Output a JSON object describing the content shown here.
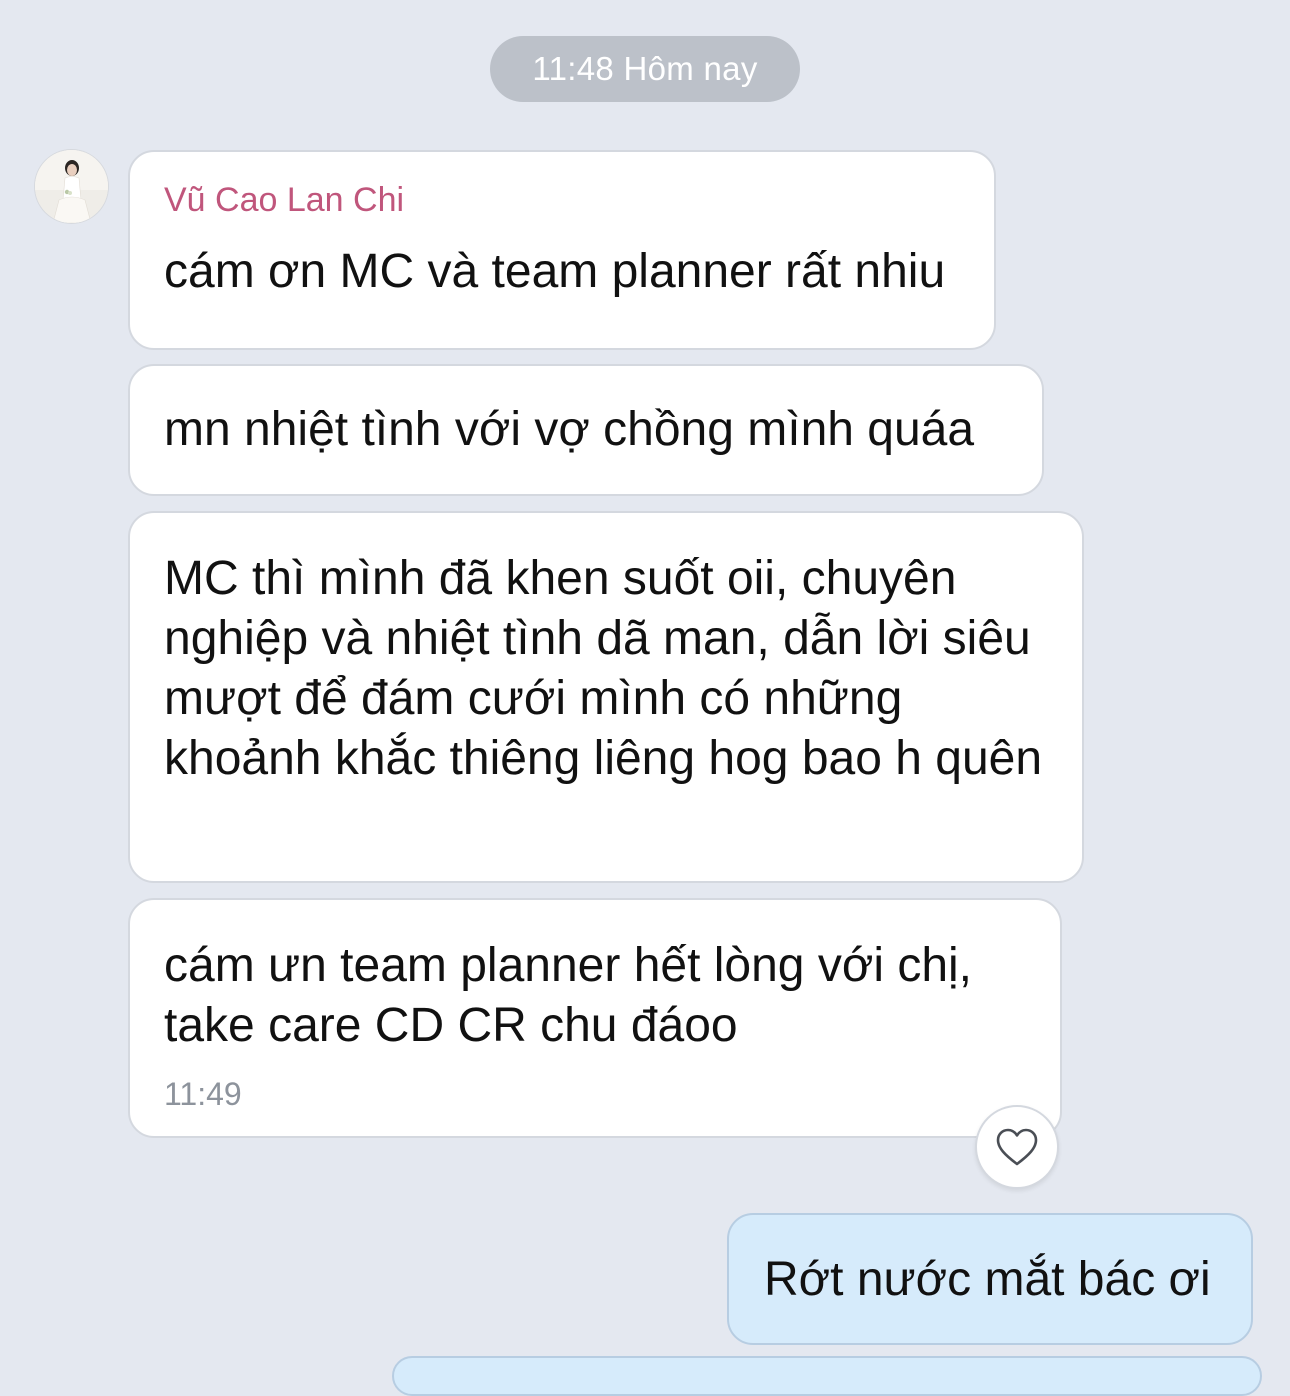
{
  "timestamp_divider": "11:48 Hôm nay",
  "incoming": {
    "sender_name": "Vũ Cao Lan Chi",
    "messages": [
      "cám ơn MC và team planner rất nhiu",
      "mn nhiệt tình với vợ chồng mình quáa",
      "MC thì mình đã khen suốt oii, chuyên nghiệp và nhiệt tình dã man, dẫn lời siêu mượt để đám cưới mình có những khoảnh khắc thiêng liêng hog bao h quên",
      "cám ưn team planner hết lòng với chị, take care CD CR chu đáoo"
    ],
    "time": "11:49"
  },
  "outgoing": {
    "messages": [
      "Rớt nước mắt bác ơi"
    ]
  },
  "icons": {
    "avatar": "sender-avatar",
    "react": "heart-icon"
  },
  "colors": {
    "background": "#e4e8f0",
    "sender_name": "#c0567c",
    "outgoing_bubble": "#d6ebfb",
    "incoming_bubble": "#ffffff"
  }
}
